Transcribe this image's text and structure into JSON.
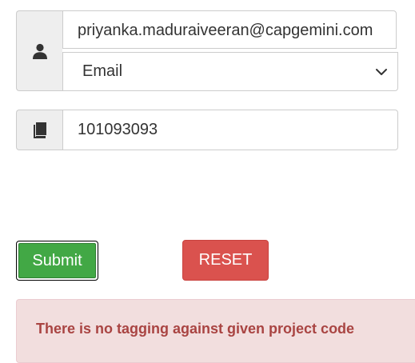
{
  "form": {
    "user": {
      "icon": "user-icon",
      "email_value": "priyanka.maduraiveeran@capgemini.com",
      "type_selected": "Email"
    },
    "project": {
      "icon": "book-icon",
      "code_value": "101093093"
    }
  },
  "actions": {
    "submit_label": "Submit",
    "reset_label": "RESET"
  },
  "alert": {
    "message": "There is no tagging against given project code"
  },
  "colors": {
    "submit": "#42a845",
    "reset": "#da524e",
    "alert_bg": "#f2dede",
    "alert_text": "#a94442"
  }
}
